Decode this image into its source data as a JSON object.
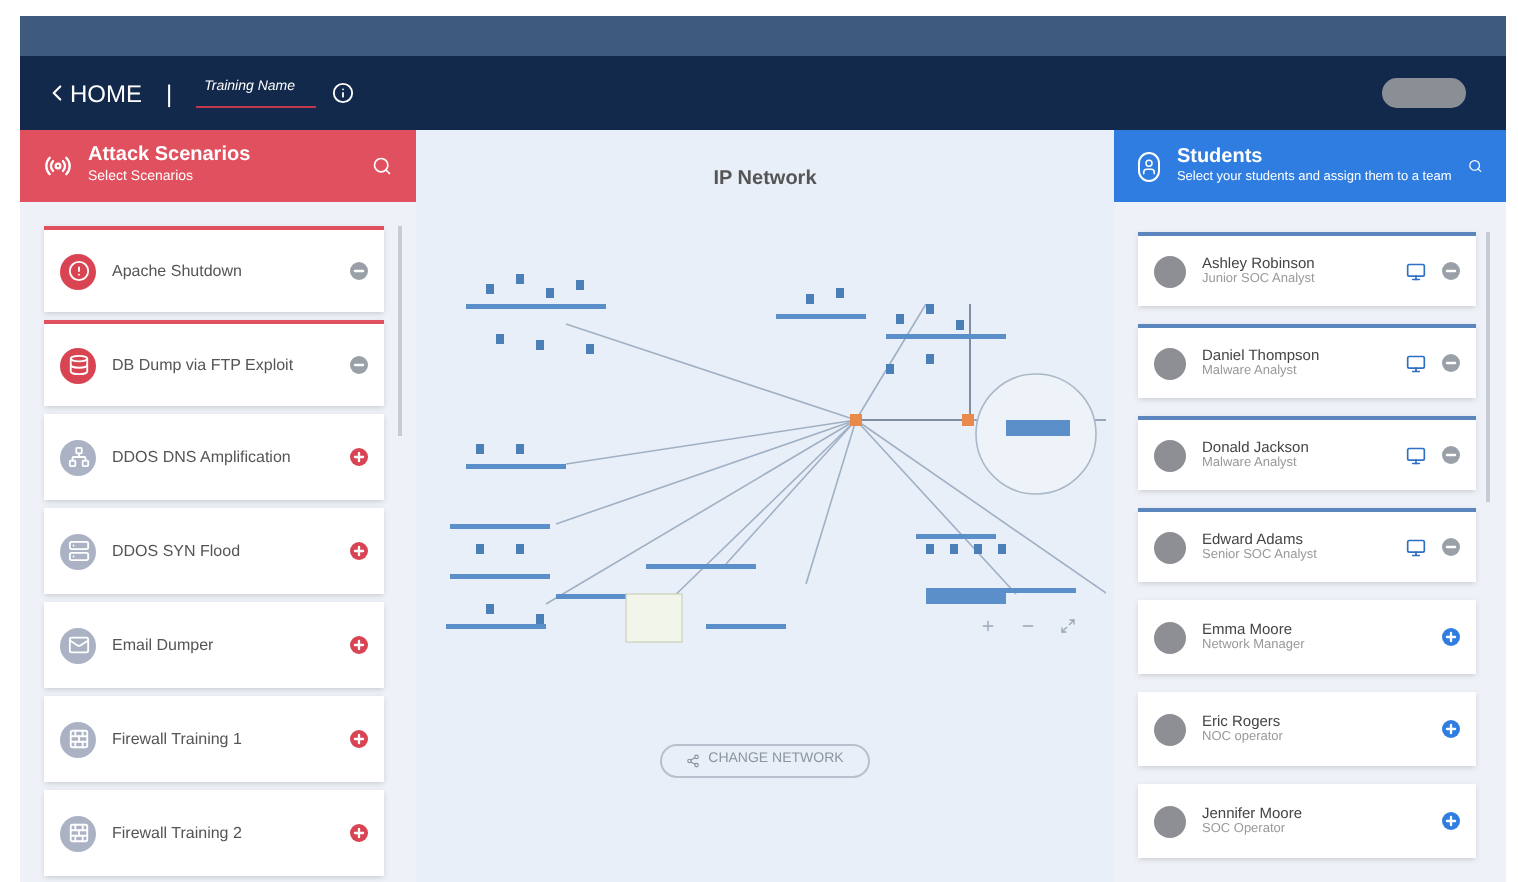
{
  "header": {
    "back": "HOME",
    "separator": "|",
    "training_name": "Training Name",
    "action_button": {
      "disabled": true
    }
  },
  "scenarios": {
    "title": "Attack Scenarios",
    "subtitle": "Select Scenarios",
    "items": [
      {
        "name": "Apache Shutdown",
        "selected": true
      },
      {
        "name": "DB Dump via FTP Exploit",
        "selected": true
      },
      {
        "name": "DDOS DNS Amplification",
        "selected": false
      },
      {
        "name": "DDOS SYN Flood",
        "selected": false
      },
      {
        "name": "Email Dumper",
        "selected": false
      },
      {
        "name": "Firewall Training 1",
        "selected": false
      },
      {
        "name": "Firewall Training 2",
        "selected": false
      }
    ]
  },
  "network": {
    "title": "IP Network",
    "change_button": "CHANGE NETWORK"
  },
  "students": {
    "title": "Students",
    "subtitle": "Select your students and assign them to a team",
    "items": [
      {
        "name": "Ashley Robinson",
        "role": "Junior SOC Analyst",
        "selected": true
      },
      {
        "name": "Daniel Thompson",
        "role": "Malware Analyst",
        "selected": true
      },
      {
        "name": "Donald Jackson",
        "role": "Malware Analyst",
        "selected": true
      },
      {
        "name": "Edward Adams",
        "role": "Senior SOC Analyst",
        "selected": true
      },
      {
        "name": "Emma Moore",
        "role": "Network Manager",
        "selected": false
      },
      {
        "name": "Eric Rogers",
        "role": "NOC operator",
        "selected": false
      },
      {
        "name": "Jennifer Moore",
        "role": "SOC Operator",
        "selected": false
      }
    ]
  }
}
